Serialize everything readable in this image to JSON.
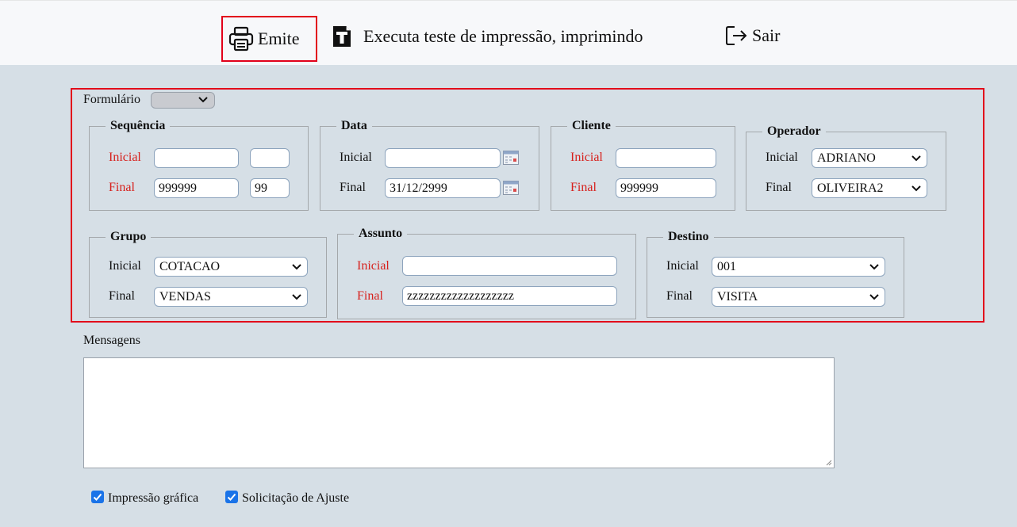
{
  "toolbar": {
    "emite_label": "Emite",
    "teste_label": "Executa teste de impressão, imprimindo",
    "sair_label": "Sair",
    "emite_icon": "printer-icon",
    "teste_icon": "font-bold-icon",
    "sair_icon": "logout-icon"
  },
  "form": {
    "formulario_label": "Formulário",
    "formulario_value": ""
  },
  "sequencia": {
    "legend": "Sequência",
    "inicial_label": "Inicial",
    "final_label": "Final",
    "inicial_value": "",
    "inicial_value2": "",
    "final_value": "999999",
    "final_value2": "99"
  },
  "data_grp": {
    "legend": "Data",
    "inicial_label": "Inicial",
    "final_label": "Final",
    "inicial_value": "",
    "final_value": "31/12/2999"
  },
  "cliente": {
    "legend": "Cliente",
    "inicial_label": "Inicial",
    "final_label": "Final",
    "inicial_value": "",
    "final_value": "999999"
  },
  "operador": {
    "legend": "Operador",
    "inicial_label": "Inicial",
    "final_label": "Final",
    "inicial_value": "ADRIANO",
    "final_value": "OLIVEIRA2"
  },
  "grupo": {
    "legend": "Grupo",
    "inicial_label": "Inicial",
    "final_label": "Final",
    "inicial_value": "COTACAO",
    "final_value": "VENDAS"
  },
  "assunto": {
    "legend": "Assunto",
    "inicial_label": "Inicial",
    "final_label": "Final",
    "inicial_value": "",
    "final_value": "zzzzzzzzzzzzzzzzzzz"
  },
  "destino": {
    "legend": "Destino",
    "inicial_label": "Inicial",
    "final_label": "Final",
    "inicial_value": "001",
    "final_value": "VISITA"
  },
  "mensagens": {
    "label": "Mensagens",
    "value": ""
  },
  "options": {
    "impressao_grafica_label": "Impressão gráfica",
    "impressao_grafica_checked": true,
    "solicitacao_ajuste_label": "Solicitação de Ajuste",
    "solicitacao_ajuste_checked": true
  },
  "colors": {
    "required_label": "#d7201c",
    "highlight_border": "#e2001a",
    "panel_background": "#d6dfe6",
    "checkbox": "#1a73e8"
  }
}
